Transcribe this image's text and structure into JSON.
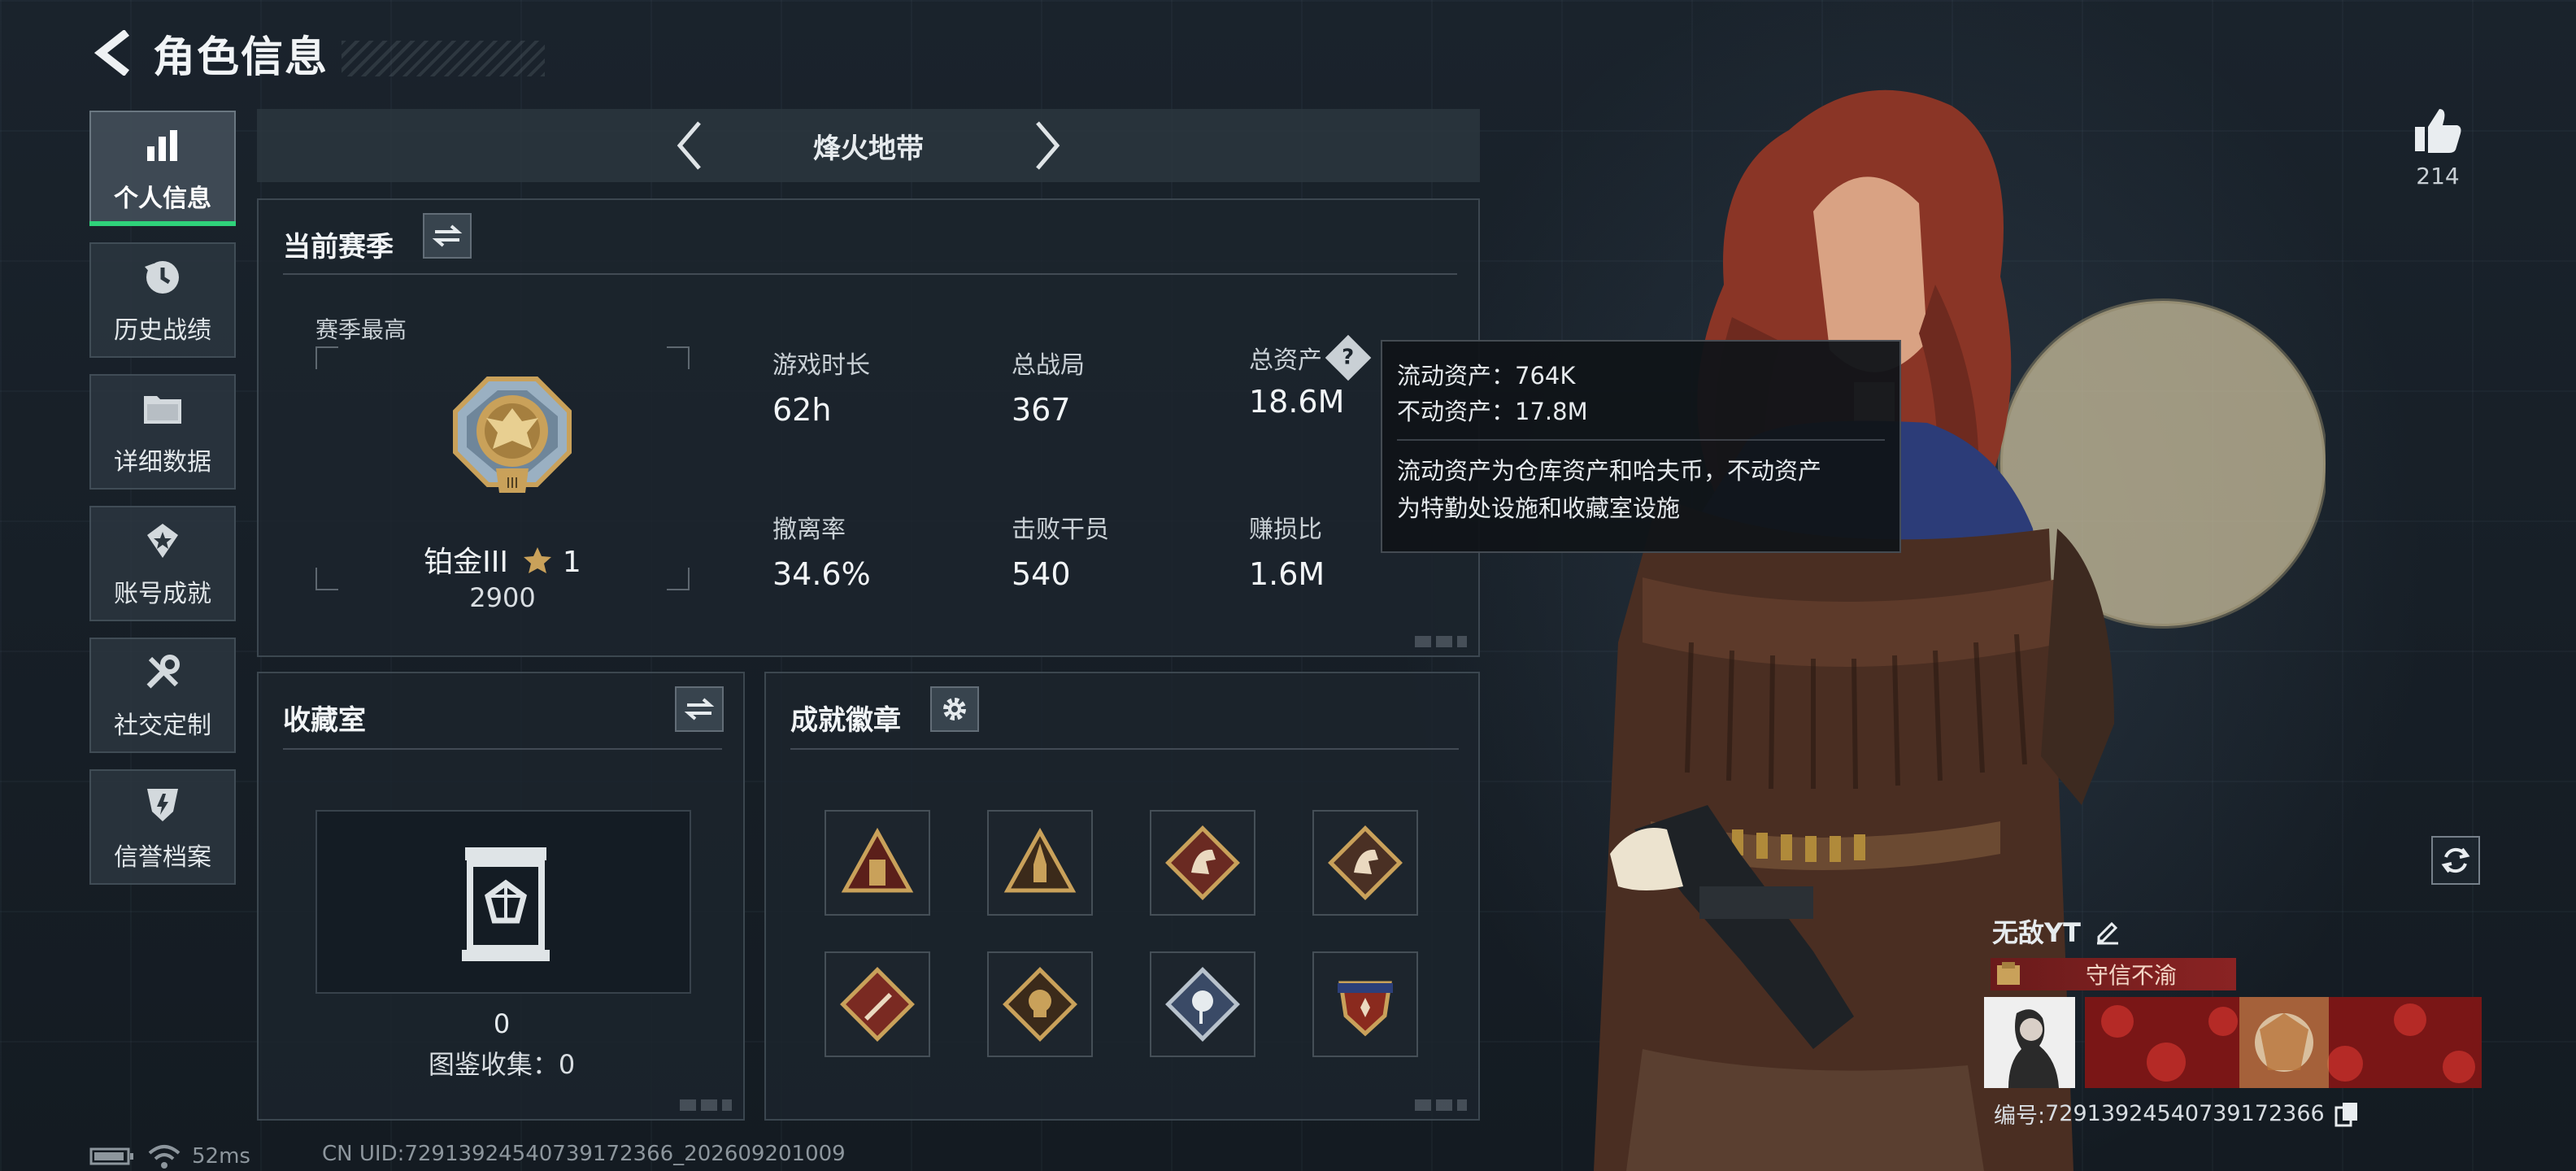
{
  "header": {
    "title": "角色信息"
  },
  "nav": {
    "items": [
      {
        "label": "个人信息",
        "icon": "bar-chart-icon",
        "active": true
      },
      {
        "label": "历史战绩",
        "icon": "history-clock-icon",
        "active": false
      },
      {
        "label": "详细数据",
        "icon": "folder-icon",
        "active": false
      },
      {
        "label": "账号成就",
        "icon": "achievement-icon",
        "active": false
      },
      {
        "label": "社交定制",
        "icon": "tools-icon",
        "active": false
      },
      {
        "label": "信誉档案",
        "icon": "shield-icon",
        "active": false
      }
    ]
  },
  "mode": {
    "title": "烽火地带"
  },
  "season": {
    "title": "当前赛季",
    "subtitle": "赛季最高",
    "rank_name": "铂金III",
    "rank_stars": "1",
    "rank_score": "2900",
    "stats": [
      {
        "label": "游戏时长",
        "value": "62h"
      },
      {
        "label": "总战局",
        "value": "367"
      },
      {
        "label": "总资产",
        "value": "18.6M"
      },
      {
        "label": "撤离率",
        "value": "34.6%"
      },
      {
        "label": "击败干员",
        "value": "540"
      },
      {
        "label": "赚损比",
        "value": "1.6M"
      }
    ]
  },
  "tooltip": {
    "liquid": "流动资产：764K",
    "fixed": "不动资产：17.8M",
    "note_line1": "流动资产为仓库资产和哈夫币，不动资产",
    "note_line2": "为特勤处设施和收藏室设施"
  },
  "collection": {
    "title": "收藏室",
    "count": "0",
    "label": "图鉴收集：0"
  },
  "badges": {
    "title": "成就徽章",
    "items": [
      "pyramid-badge-icon",
      "rocket-badge-icon",
      "horse-badge-icon",
      "horse-badge-icon",
      "knife-badge-icon",
      "skull-badge-icon",
      "rose-badge-icon",
      "shield-badge-icon"
    ]
  },
  "profile": {
    "likes": "214",
    "player_name": "无敌YT",
    "title_tag": "守信不渝",
    "id_label": "编号:",
    "id_value": "7291392454073917236​6"
  },
  "status": {
    "ping": "52ms",
    "uid": "CN UID:72913924540739172366_202609201009"
  },
  "colors": {
    "accent_green": "#2fd27a",
    "tag_red": "#8a2323",
    "gold": "#c9a15a"
  }
}
